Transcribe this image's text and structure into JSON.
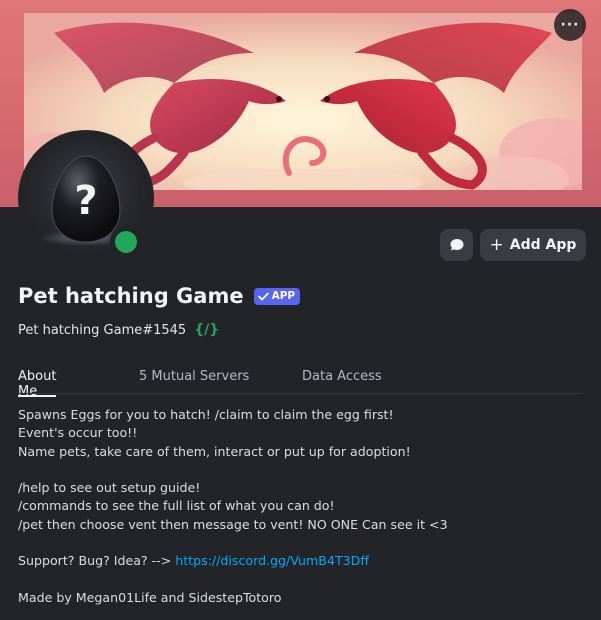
{
  "header": {
    "more_icon": "more-horizontal-icon",
    "more_label": "···"
  },
  "profile": {
    "display_name": "Pet hatching Game",
    "badge_label": "APP",
    "username": "Pet hatching Game#1545",
    "slash_commands_label": "{/}",
    "status": "online",
    "status_color": "#23a55a"
  },
  "actions": {
    "message_icon": "chat-bubble-icon",
    "add_app_label": "Add App"
  },
  "tabs": [
    {
      "label": "About Me",
      "active": true
    },
    {
      "label": "5 Mutual Servers",
      "active": false
    },
    {
      "label": "Data Access",
      "active": false
    }
  ],
  "about": {
    "line1": "Spawns Eggs for you to hatch! /claim to claim the egg first!",
    "line2": "Event's occur too!!",
    "line3": "Name pets, take care of them, interact or put up for adoption!",
    "line4": "/help to see out setup guide!",
    "line5": "/commands to see the full list of what you can do!",
    "line6": "/pet then choose vent then message to vent! NO ONE Can see it <3",
    "support_prefix": "Support? Bug? Idea? --> ",
    "support_link": "https://discord.gg/VumB4T3Dff",
    "credits": "Made by Megan01Life and SidestepTotoro"
  },
  "colors": {
    "background": "#232428",
    "accent": "#5865f2",
    "link": "#00a8fc",
    "online": "#23a55a"
  }
}
